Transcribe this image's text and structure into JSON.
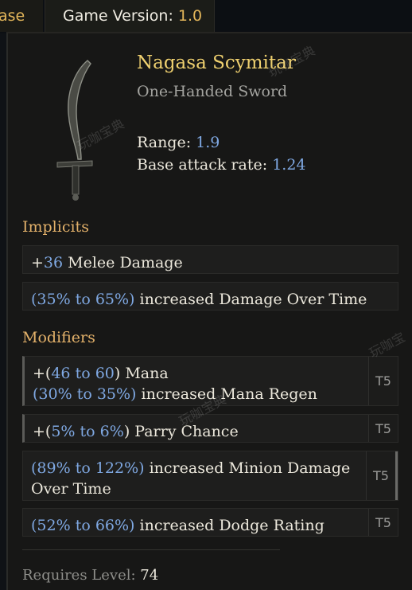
{
  "tabs": {
    "left_partial": "ase",
    "active_label": "Game Version:",
    "active_value": "1.0"
  },
  "item": {
    "name": "Nagasa Scymitar",
    "type": "One-Handed Sword",
    "range_label": "Range:",
    "range_value": "1.9",
    "attack_rate_label": "Base attack rate:",
    "attack_rate_value": "1.24"
  },
  "implicits": {
    "heading": "Implicits",
    "items": [
      {
        "prefix": "+",
        "value": "36",
        "text": " Melee Damage"
      },
      {
        "open": "(",
        "min": "35%",
        "mid": " to ",
        "max": "65%",
        "close": ")",
        "text": " increased Damage Over Time"
      }
    ]
  },
  "modifiers": {
    "heading": "Modifiers",
    "items": [
      {
        "line1_open": "+(",
        "line1_min": "46",
        "line1_mid": " to ",
        "line1_max": "60",
        "line1_close": ")",
        "line1_text": " Mana",
        "line2_open": "(",
        "line2_min": "30%",
        "line2_mid": " to ",
        "line2_max": "35%",
        "line2_close": ")",
        "line2_text": " increased Mana Regen",
        "tier": "T5"
      },
      {
        "open": "+(",
        "min": "5%",
        "mid": " to ",
        "max": "6%",
        "close": ")",
        "text": " Parry Chance",
        "tier": "T5"
      },
      {
        "open": "(",
        "min": "89%",
        "mid": " to ",
        "max": "122%",
        "close": ")",
        "text": " increased Minion Damage",
        "text2": "Over Time",
        "tier": "T5"
      },
      {
        "open": "(",
        "min": "52%",
        "mid": " to ",
        "max": "66%",
        "close": ")",
        "text": " increased Dodge Rating",
        "tier": "T5"
      }
    ]
  },
  "requirement": {
    "label": "Requires Level:",
    "value": "74"
  },
  "watermarks": [
    "玩咖宝典",
    "玩咖宝典",
    "玩咖宝典",
    "玩咖宝"
  ],
  "colors": {
    "title": "#efd06f",
    "number": "#7fa8e2",
    "section": "#e3b16a"
  }
}
